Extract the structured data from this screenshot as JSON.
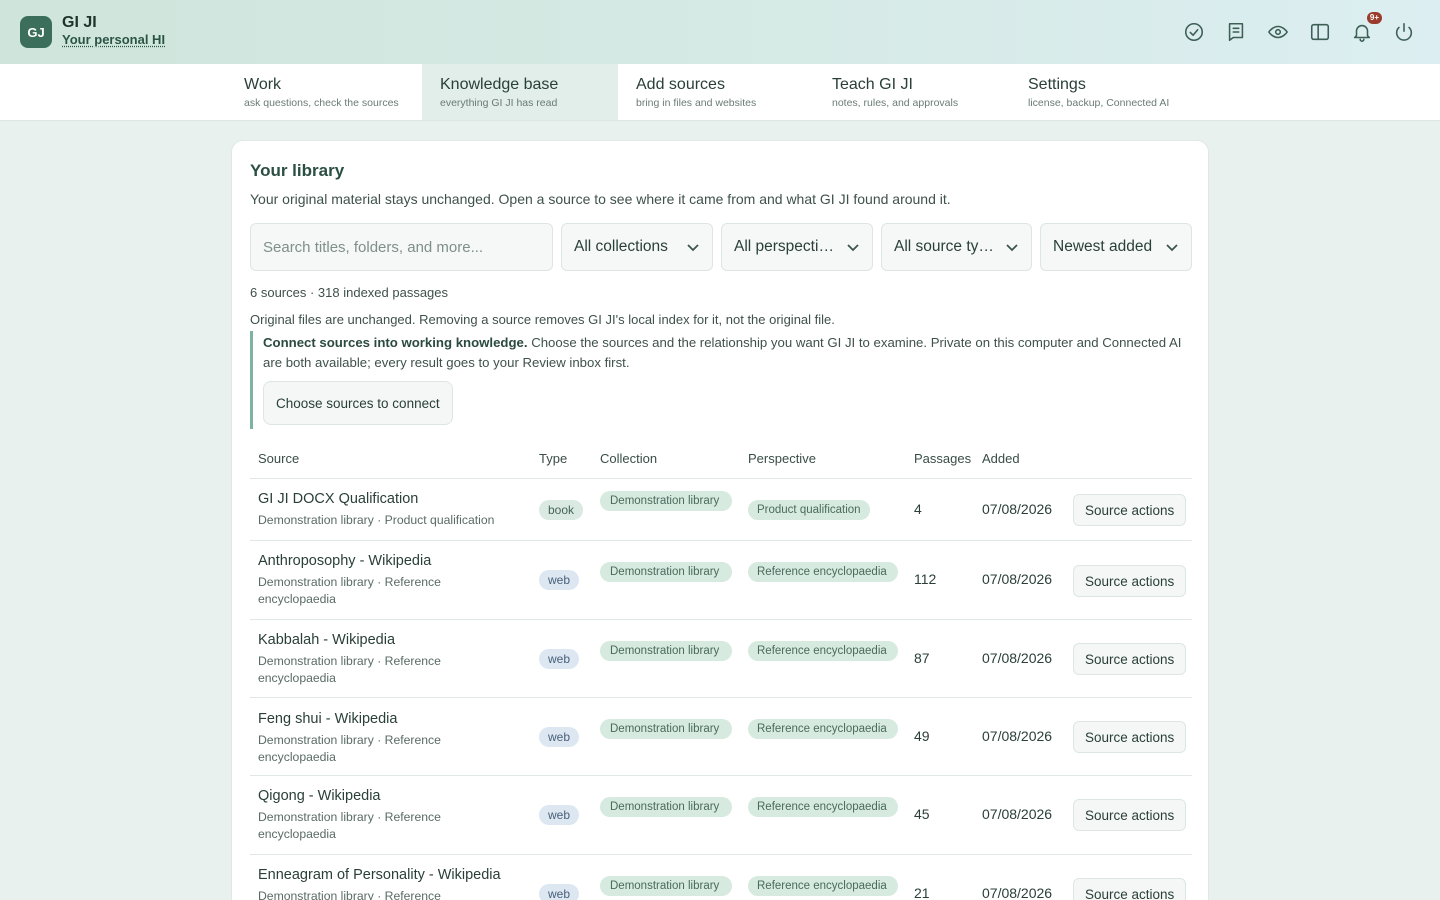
{
  "app": {
    "logo_initials": "GJ",
    "name": "GI JI",
    "subtitle": "Your personal HI",
    "notification_count": "9+"
  },
  "header_icons": [
    "check-circle-icon",
    "notebook-icon",
    "eye-icon",
    "sidebar-icon",
    "bell-icon",
    "power-icon"
  ],
  "tabs": [
    {
      "title": "Work",
      "subtitle": "ask questions, check the sources"
    },
    {
      "title": "Knowledge base",
      "subtitle": "everything GI JI has read"
    },
    {
      "title": "Add sources",
      "subtitle": "bring in files and websites"
    },
    {
      "title": "Teach GI JI",
      "subtitle": "notes, rules, and approvals"
    },
    {
      "title": "Settings",
      "subtitle": "license, backup, Connected AI"
    }
  ],
  "active_tab": "Knowledge base",
  "library": {
    "title": "Your library",
    "description": "Your original material stays unchanged. Open a source to see where it came from and what GI JI found around it.",
    "search_placeholder": "Search titles, folders, and more...",
    "filters": {
      "collections": "All collections",
      "perspectives": "All perspectives",
      "source_types": "All source types",
      "sort": "Newest added"
    },
    "count_text": "6 sources · 318 indexed passages",
    "note": "Original files are unchanged. Removing a source removes GI JI's local index for it, not the original file.",
    "connect": {
      "bold": "Connect sources into working knowledge.",
      "text": " Choose the sources and the relationship you want GI JI to examine. Private on this computer and Connected AI are both available; every result goes to your Review inbox first.",
      "button": "Choose sources to connect"
    },
    "columns": {
      "source": "Source",
      "type": "Type",
      "collection": "Collection",
      "perspective": "Perspective",
      "passages": "Passages",
      "added": "Added"
    },
    "action_label": "Source actions",
    "rows": [
      {
        "title": "GI JI DOCX Qualification",
        "meta": "Demonstration library · Product qualification",
        "type": "book",
        "collection": "Demonstration library",
        "perspective": "Product qualification",
        "passages": "4",
        "added": "07/08/2026"
      },
      {
        "title": "Anthroposophy - Wikipedia",
        "meta": "Demonstration library · Reference encyclopaedia",
        "type": "web",
        "collection": "Demonstration library",
        "perspective": "Reference encyclopaedia",
        "passages": "112",
        "added": "07/08/2026"
      },
      {
        "title": "Kabbalah - Wikipedia",
        "meta": "Demonstration library · Reference encyclopaedia",
        "type": "web",
        "collection": "Demonstration library",
        "perspective": "Reference encyclopaedia",
        "passages": "87",
        "added": "07/08/2026"
      },
      {
        "title": "Feng shui - Wikipedia",
        "meta": "Demonstration library · Reference encyclopaedia",
        "type": "web",
        "collection": "Demonstration library",
        "perspective": "Reference encyclopaedia",
        "passages": "49",
        "added": "07/08/2026"
      },
      {
        "title": "Qigong - Wikipedia",
        "meta": "Demonstration library · Reference encyclopaedia",
        "type": "web",
        "collection": "Demonstration library",
        "perspective": "Reference encyclopaedia",
        "passages": "45",
        "added": "07/08/2026"
      },
      {
        "title": "Enneagram of Personality - Wikipedia",
        "meta": "Demonstration library · Reference encyclopaedia",
        "type": "web",
        "collection": "Demonstration library",
        "perspective": "Reference encyclopaedia",
        "passages": "21",
        "added": "07/08/2026"
      }
    ]
  }
}
